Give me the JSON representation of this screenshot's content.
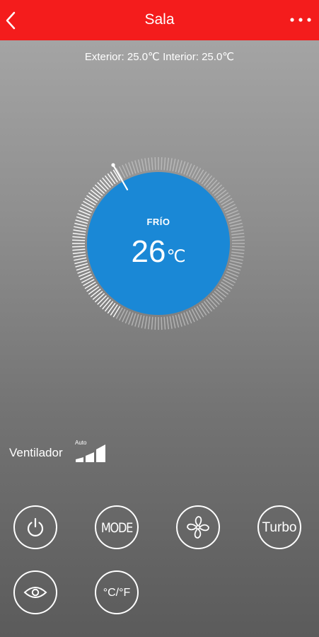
{
  "header": {
    "title": "Sala",
    "background_color": "#f41c1c",
    "back_icon": "chevron-left-icon",
    "menu_icon": "more-horizontal-icon"
  },
  "temperatures": {
    "text": "Exterior: 25.0℃ Interior: 25.0℃"
  },
  "thermostat": {
    "mode": "FRÍO",
    "temperature": "26",
    "unit": "℃",
    "accent_color": "#1a88d6",
    "setpoint_fraction": 0.4
  },
  "fan": {
    "label": "Ventilador",
    "speed": "Auto",
    "level": 3,
    "max_level": 3
  },
  "controls": {
    "power_icon": "power-icon",
    "mode_label": "MODE",
    "fan_icon": "fan-icon",
    "turbo_label": "Turbo",
    "eye_icon": "eye-icon",
    "unit_label": "°C/°F"
  }
}
